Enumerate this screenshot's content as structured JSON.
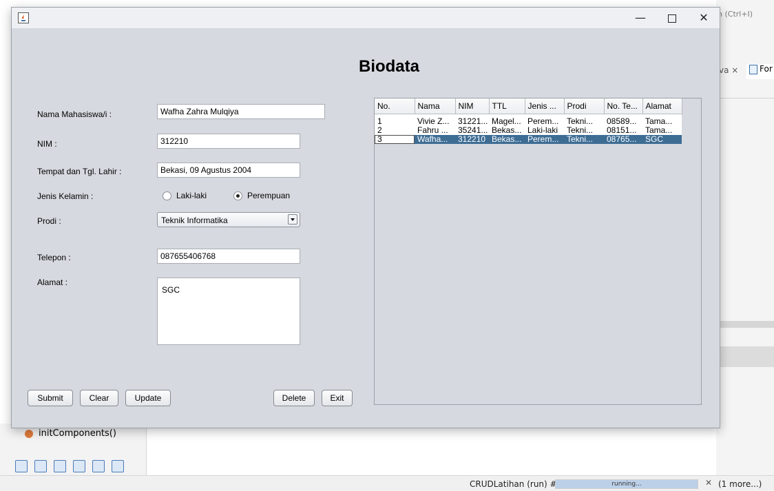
{
  "ide": {
    "search_hint": "h (Ctrl+I)",
    "tab_partial": "va ×",
    "tab_form_partial": "For",
    "navigator_item": "initComponents()",
    "status": {
      "task": "CRUDLatihan (run) #2",
      "progress_label": "running...",
      "more": "(1 more...)"
    }
  },
  "window": {
    "title": "",
    "controls": {
      "minimize": "—",
      "close": "✕"
    }
  },
  "form": {
    "title": "Biodata",
    "labels": {
      "nama": "Nama Mahasiswa/i :",
      "nim": "NIM :",
      "ttl": "Tempat dan Tgl. Lahir :",
      "jenis_kelamin": "Jenis Kelamin :",
      "prodi": "Prodi :",
      "telepon": "Telepon :",
      "alamat": "Alamat :"
    },
    "values": {
      "nama": "Wafha Zahra Mulqiya",
      "nim": "312210",
      "ttl": "Bekasi, 09 Agustus 2004",
      "prodi": "Teknik Informatika",
      "telepon": "087655406768",
      "alamat": "SGC"
    },
    "gender": {
      "options": [
        "Laki-laki",
        "Perempuan"
      ],
      "selected": "Perempuan"
    },
    "buttons": {
      "submit": "Submit",
      "clear": "Clear",
      "update": "Update",
      "delete": "Delete",
      "exit": "Exit"
    }
  },
  "table": {
    "columns": [
      "No.",
      "Nama",
      "NIM",
      "TTL",
      "Jenis ...",
      "Prodi",
      "No. Te...",
      "Alamat"
    ],
    "rows": [
      [
        "1",
        "Vivie Z...",
        "31221...",
        "Magel...",
        "Perem...",
        "Tekni...",
        "08589...",
        "Tama..."
      ],
      [
        "2",
        "Fahru ...",
        "35241...",
        "Bekas...",
        "Laki-laki",
        "Tekni...",
        "08151...",
        "Tama..."
      ],
      [
        "3",
        "Wafha...",
        "312210",
        "Bekas...",
        "Perem...",
        "Tekni...",
        "08765...",
        "SGC"
      ]
    ],
    "selected_row": 3
  }
}
